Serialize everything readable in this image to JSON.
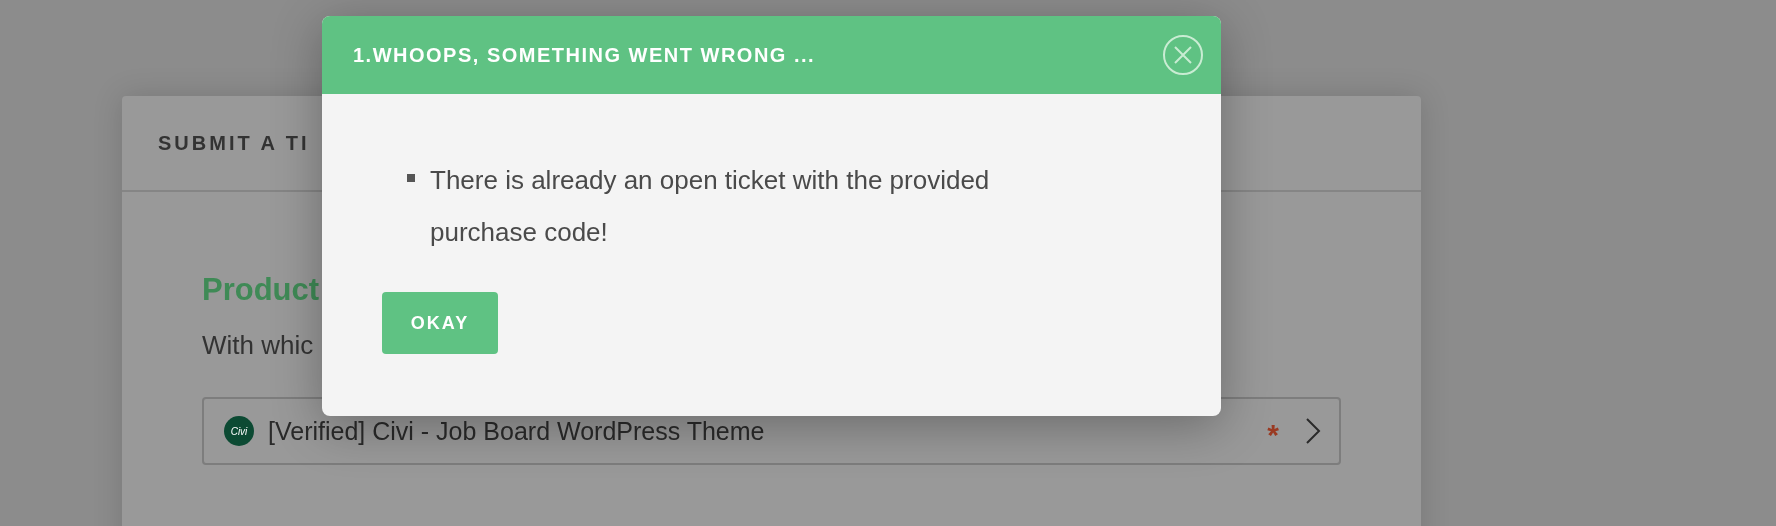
{
  "card": {
    "title": "SUBMIT A TI",
    "section_title": "Product",
    "question": "With whic",
    "select": {
      "logo_text": "Civi",
      "value": "[Verified] Civi - Job Board WordPress Theme",
      "required_mark": "*"
    }
  },
  "dialog": {
    "title": "1.WHOOPS, SOMETHING WENT WRONG ...",
    "messages": [
      "There is already an open ticket with the provided purchase code!"
    ],
    "buttons": [
      "OKAY"
    ]
  }
}
